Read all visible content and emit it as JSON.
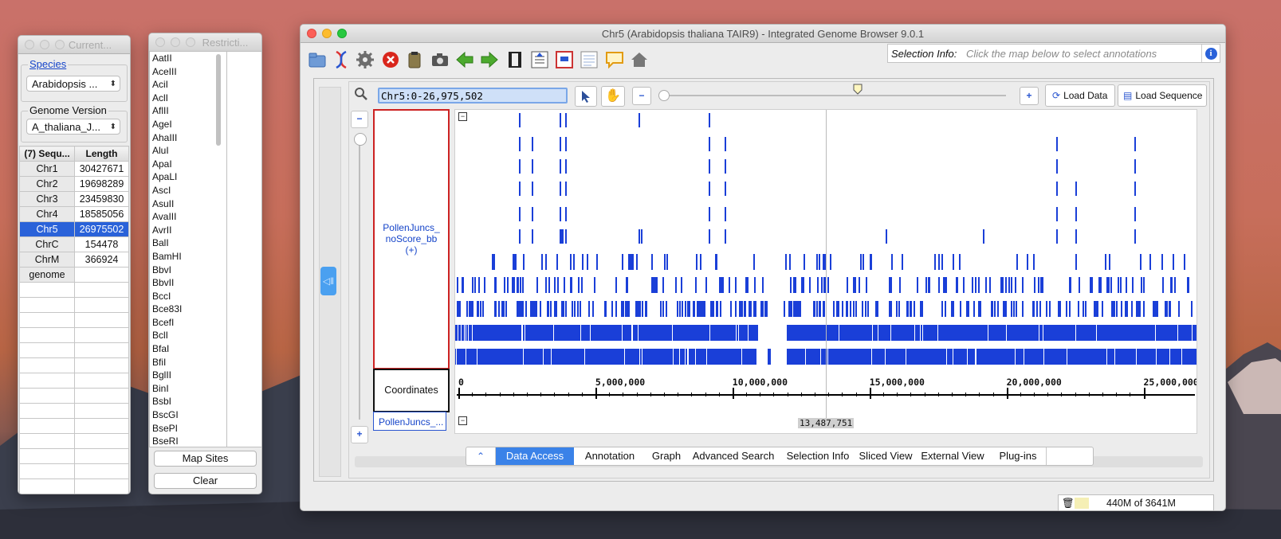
{
  "desktop": {
    "wallpaper": "sierra-mountains"
  },
  "current_window": {
    "title": "Current...",
    "species_label": "Species",
    "species_value": "Arabidopsis ...",
    "genome_version_label": "Genome Version",
    "genome_version_value": "A_thaliana_J...",
    "table_headers": [
      "(7) Sequ...",
      "Length"
    ],
    "sequences": [
      {
        "name": "Chr1",
        "length": "30427671"
      },
      {
        "name": "Chr2",
        "length": "19698289"
      },
      {
        "name": "Chr3",
        "length": "23459830"
      },
      {
        "name": "Chr4",
        "length": "18585056"
      },
      {
        "name": "Chr5",
        "length": "26975502",
        "selected": true
      },
      {
        "name": "ChrC",
        "length": "154478"
      },
      {
        "name": "ChrM",
        "length": "366924"
      },
      {
        "name": "genome",
        "length": ""
      }
    ]
  },
  "restriction_window": {
    "title": "Restricti...",
    "enzymes": [
      "AatII",
      "AceIII",
      "AciI",
      "AclI",
      "AflII",
      "AgeI",
      "AhaIII",
      "AluI",
      "ApaI",
      "ApaLI",
      "AscI",
      "AsuII",
      "AvaIII",
      "AvrII",
      "BalI",
      "BamHI",
      "BbvI",
      "BbvII",
      "BccI",
      "Bce83I",
      "BcefI",
      "BclI",
      "BfaI",
      "BfiI",
      "BglII",
      "BinI",
      "BsbI",
      "BscGI",
      "BsePI",
      "BseRI"
    ],
    "map_sites_label": "Map Sites",
    "clear_label": "Clear"
  },
  "main_window": {
    "title": "Chr5  (Arabidopsis thaliana TAIR9) - Integrated Genome Browser 9.0.1",
    "toolbar_icons": [
      "open-folder-icon",
      "dna-icon",
      "gear-icon",
      "stop-icon",
      "clipboard-icon",
      "camera-icon",
      "back-arrow-icon",
      "forward-arrow-icon",
      "film-icon",
      "export-icon",
      "print-icon",
      "blank-doc-icon",
      "comment-icon",
      "home-icon"
    ],
    "selection_info_label": "Selection Info:",
    "selection_info_placeholder": "Click the map below to select annotations",
    "location": "Chr5:0-26,975,502",
    "load_data_label": "Load Data",
    "load_sequence_label": "Load Sequence",
    "track_label_lines": [
      "PollenJuncs_",
      "noScore_bb",
      "(+)"
    ],
    "coordinates_label": "Coordinates",
    "bottom_track_label": "PollenJuncs_...",
    "axis_ticks": [
      "0",
      "5,000,000",
      "10,000,000",
      "15,000,000",
      "20,000,000",
      "25,000,000"
    ],
    "cursor_position": "13,487,751",
    "tabs": [
      "Data Access",
      "Annotation",
      "Graph",
      "Advanced Search",
      "Selection Info",
      "Sliced View",
      "External View",
      "Plug-ins"
    ],
    "active_tab": "Data Access",
    "memory": "440M of 3641M",
    "colors": {
      "feature": "#1a3fd8",
      "selection": "#2a62d9",
      "track_border": "#cc2222"
    }
  }
}
